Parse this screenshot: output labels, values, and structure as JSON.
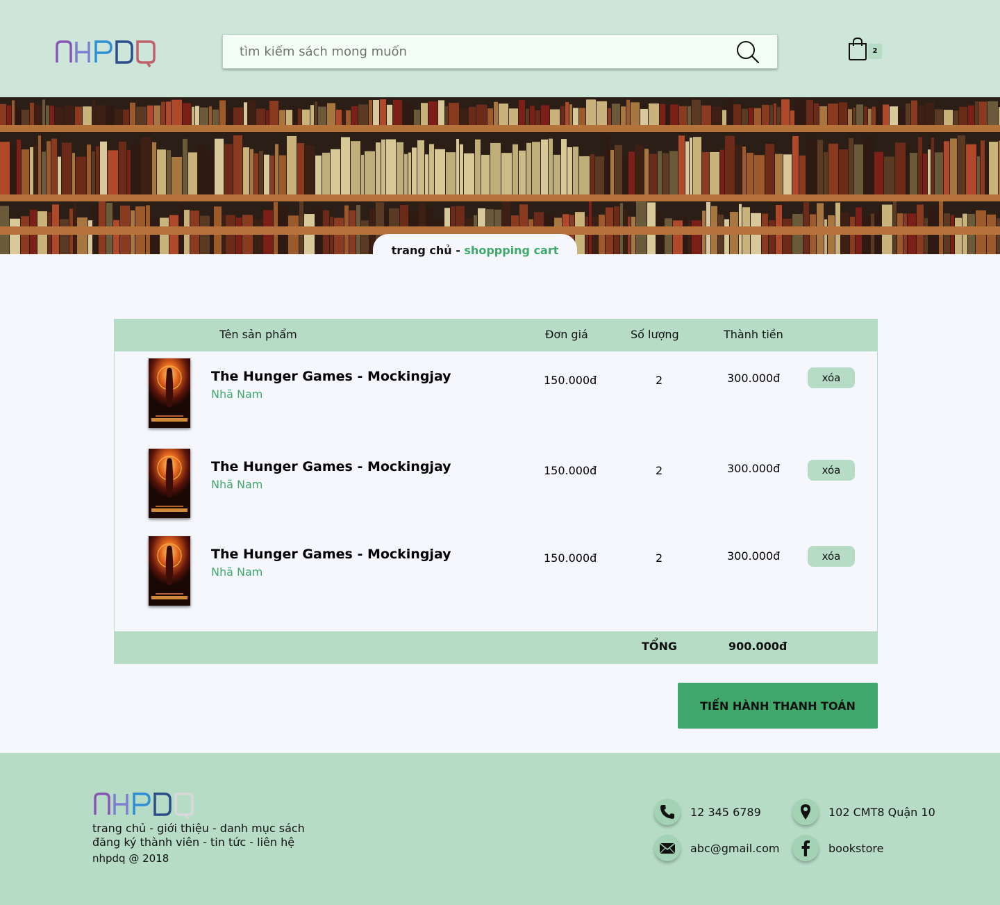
{
  "brand": {
    "logo_text": "NHPDQ"
  },
  "search": {
    "placeholder": "tìm kiếm sách mong muốn"
  },
  "cart": {
    "count": "2"
  },
  "breadcrumb": {
    "home": "trang chủ",
    "separator": " - ",
    "current": "shoppping cart"
  },
  "table": {
    "headers": {
      "name": "Tên sản phẩm",
      "price": "Đơn giá",
      "qty": "Số lượng",
      "subtotal": "Thành tiền"
    },
    "rows": [
      {
        "title": "The Hunger Games - Mockingjay",
        "publisher": "Nhã Nam",
        "price": "150.000đ",
        "qty": "2",
        "subtotal": "300.000đ",
        "action": "xóa"
      },
      {
        "title": "The Hunger Games - Mockingjay",
        "publisher": "Nhã Nam",
        "price": "150.000đ",
        "qty": "2",
        "subtotal": "300.000đ",
        "action": "xóa"
      },
      {
        "title": "The Hunger Games - Mockingjay",
        "publisher": "Nhã Nam",
        "price": "150.000đ",
        "qty": "2",
        "subtotal": "300.000đ",
        "action": "xóa"
      }
    ],
    "total_label": "TỔNG",
    "total_value": "900.000đ"
  },
  "checkout": {
    "label": "TIẾN HÀNH THANH TOÁN"
  },
  "footer": {
    "nav_line1": [
      "trang chủ",
      "giới thiệu",
      "danh mục sách"
    ],
    "nav_line2": [
      "đăng ký thành viên",
      "tin tức",
      "liên hệ"
    ],
    "separator": " - ",
    "copyright": "nhpdq @ 2018",
    "contacts": {
      "phone": "12 345 6789",
      "address": "102 CMT8 Quận 10",
      "email": "abc@gmail.com",
      "facebook": "bookstore"
    }
  },
  "colors": {
    "header_bg": "#cde6d9",
    "accent": "#3fa86a",
    "light_green": "#b6dcc6",
    "page_bg": "#f5f7fd"
  },
  "icons": [
    "search-icon",
    "shopping-bag-icon",
    "phone-icon",
    "map-pin-icon",
    "mail-icon",
    "facebook-icon"
  ]
}
